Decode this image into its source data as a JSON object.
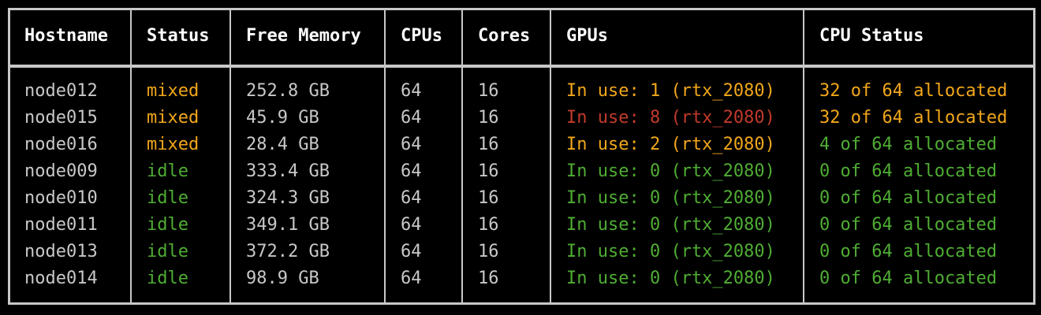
{
  "colors": {
    "text": "#c8c8c8",
    "header": "#ffffff",
    "mixed": "#f2a71b",
    "idle": "#4fad33",
    "busy": "#c23a2b",
    "border": "#c8c8c8",
    "background": "#000000"
  },
  "columns": [
    "Hostname",
    "Status",
    "Free Memory",
    "CPUs",
    "Cores",
    "GPUs",
    "CPU Status"
  ],
  "rows": [
    {
      "hostname": "node012",
      "status": "mixed",
      "free_memory": "252.8 GB",
      "cpus": "64",
      "cores": "16",
      "gpus": "In use: 1 (rtx_2080)",
      "cpu_status": "32 of 64 allocated",
      "status_color": "#f2a71b",
      "gpu_color": "#f2a71b",
      "cpu_status_color": "#f2a71b"
    },
    {
      "hostname": "node015",
      "status": "mixed",
      "free_memory": "45.9 GB",
      "cpus": "64",
      "cores": "16",
      "gpus": "In use: 8 (rtx_2080)",
      "cpu_status": "32 of 64 allocated",
      "status_color": "#f2a71b",
      "gpu_color": "#c23a2b",
      "cpu_status_color": "#f2a71b"
    },
    {
      "hostname": "node016",
      "status": "mixed",
      "free_memory": "28.4 GB",
      "cpus": "64",
      "cores": "16",
      "gpus": "In use: 2 (rtx_2080)",
      "cpu_status": "4 of 64 allocated",
      "status_color": "#f2a71b",
      "gpu_color": "#f2a71b",
      "cpu_status_color": "#4fad33"
    },
    {
      "hostname": "node009",
      "status": "idle",
      "free_memory": "333.4 GB",
      "cpus": "64",
      "cores": "16",
      "gpus": "In use: 0 (rtx_2080)",
      "cpu_status": "0 of 64 allocated",
      "status_color": "#4fad33",
      "gpu_color": "#4fad33",
      "cpu_status_color": "#4fad33"
    },
    {
      "hostname": "node010",
      "status": "idle",
      "free_memory": "324.3 GB",
      "cpus": "64",
      "cores": "16",
      "gpus": "In use: 0 (rtx_2080)",
      "cpu_status": "0 of 64 allocated",
      "status_color": "#4fad33",
      "gpu_color": "#4fad33",
      "cpu_status_color": "#4fad33"
    },
    {
      "hostname": "node011",
      "status": "idle",
      "free_memory": "349.1 GB",
      "cpus": "64",
      "cores": "16",
      "gpus": "In use: 0 (rtx_2080)",
      "cpu_status": "0 of 64 allocated",
      "status_color": "#4fad33",
      "gpu_color": "#4fad33",
      "cpu_status_color": "#4fad33"
    },
    {
      "hostname": "node013",
      "status": "idle",
      "free_memory": "372.2 GB",
      "cpus": "64",
      "cores": "16",
      "gpus": "In use: 0 (rtx_2080)",
      "cpu_status": "0 of 64 allocated",
      "status_color": "#4fad33",
      "gpu_color": "#4fad33",
      "cpu_status_color": "#4fad33"
    },
    {
      "hostname": "node014",
      "status": "idle",
      "free_memory": "98.9 GB",
      "cpus": "64",
      "cores": "16",
      "gpus": "In use: 0 (rtx_2080)",
      "cpu_status": "0 of 64 allocated",
      "status_color": "#4fad33",
      "gpu_color": "#4fad33",
      "cpu_status_color": "#4fad33"
    }
  ]
}
